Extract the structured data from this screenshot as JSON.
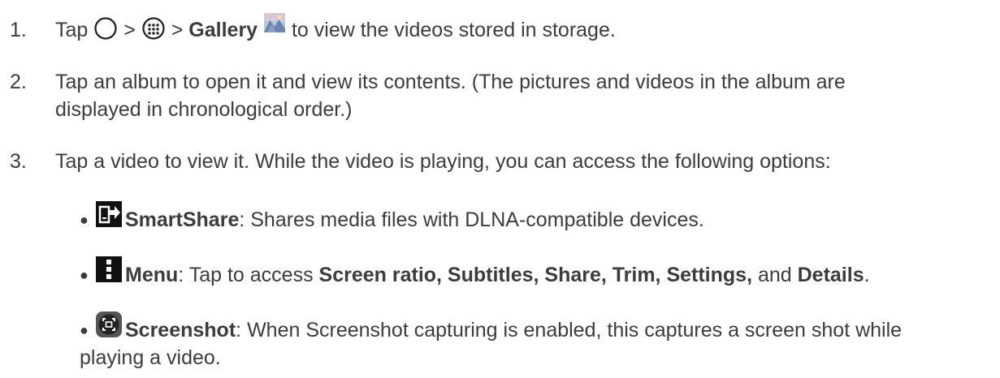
{
  "steps": [
    {
      "num": "1.",
      "pre": "Tap",
      "sep1": ">",
      "sep2": ">",
      "bold": "Gallery",
      "post": "to view the videos stored in storage."
    },
    {
      "num": "2.",
      "line1": "Tap an album to open it and view its contents. (The pictures and videos in the album are",
      "line2": "displayed in chronological order.)"
    },
    {
      "num": "3.",
      "text": "Tap a video to view it. While the video is playing, you can access the following options:"
    }
  ],
  "options": [
    {
      "icon": "smartshare-icon",
      "label": "SmartShare",
      "desc": ": Shares media files with DLNA-compatible devices."
    },
    {
      "icon": "menu-dots-icon",
      "label": "Menu",
      "desc_pre": ": Tap to access ",
      "bold_items": "Screen ratio, Subtitles, Share, Trim, Settings,",
      "and_text": " and ",
      "last_bold": "Details",
      "period": "."
    },
    {
      "icon": "screenshot-icon",
      "label": "Screenshot",
      "desc_line1": ": When Screenshot capturing is enabled, this captures a screen shot while",
      "desc_line2": "playing a video."
    }
  ]
}
